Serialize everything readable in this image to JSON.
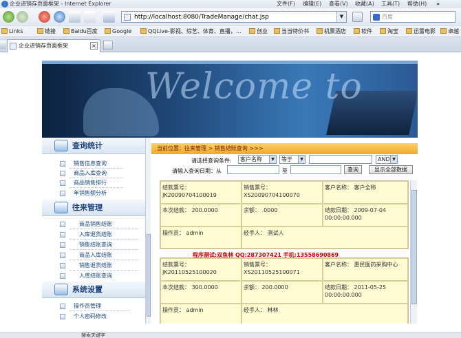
{
  "window": {
    "title": "企业进销存页面框架 - Internet Explorer",
    "menu": [
      "文件(F)",
      "编辑(E)",
      "查看(V)",
      "收藏(A)",
      "工具(T)",
      "帮助(H)"
    ]
  },
  "address": {
    "url": "http://localhost:8080/TradeManage/chat.jsp",
    "search_placeholder": "百度"
  },
  "links": [
    "Links",
    "链接",
    "Baidu百度",
    "Google",
    "QQLive-影视、综艺、体育、直播，...",
    "创业",
    "当当特价书",
    "机票酒店",
    "软件",
    "淘宝",
    "迅雷电影",
    "卓越"
  ],
  "tab": {
    "title": "企业进销存页面框架"
  },
  "banner": {
    "text": "Welcome to"
  },
  "sidebar": {
    "sections": [
      {
        "title": "查询统计",
        "items": [
          "销售信息查询",
          "商品入库查询",
          "商品销售排行",
          "年销售额分析"
        ]
      },
      {
        "title": "往来管理",
        "items": [
          "商品销售结账",
          "入库退货结账",
          "销售结账查询",
          "商品入库结账",
          "销售退货结账",
          "入库结账查询"
        ]
      },
      {
        "title": "系统设置",
        "items": [
          "操作员管理",
          "个人密码修改"
        ]
      }
    ]
  },
  "breadcrumb": "当前位置：往来管理 > 销售结账查询 >>>",
  "query": {
    "condition_label": "请选择查询条件:",
    "field_value": "客户名称",
    "operator_value": "等于",
    "logic_value": "AND",
    "date_label": "请输入查询日期：从",
    "to_label": "至",
    "search_button": "查询",
    "show_all_button": "显示全部数据"
  },
  "records": [
    {
      "settle_no": "结款票号：JK20090704100019",
      "sale_no": "销售票号：XS20090704100070",
      "customer": "客户名称： 客户全称",
      "amount": "本次结款： 200.0000",
      "balance": "余额： .0000",
      "date": "结款日期： 2009-07-04 00:00:00.000",
      "operator": "操作员： admin",
      "handler": "经手人： 测试人"
    },
    {
      "settle_no": "结款票号：JK20110525100020",
      "sale_no": "销售票号：XS20110525100071",
      "customer": "客户名称： 惠民医药采购中心",
      "amount": "本次结款： 300.0000",
      "balance": "余额： 200.0000",
      "date": "结款日期： 2011-05-25 00:00:00.000",
      "operator": "操作员： admin",
      "handler": "经手人： 林林"
    }
  ],
  "promo": "程序测试:双鱼林 QQ:287307421 手机:13558690869",
  "status": "搜索关键字",
  "colors": {
    "breadcrumb_bg": "#f0a828",
    "cell_bg": "#fffbd2",
    "nav_text": "#1a4880",
    "promo": "#cc0000"
  }
}
